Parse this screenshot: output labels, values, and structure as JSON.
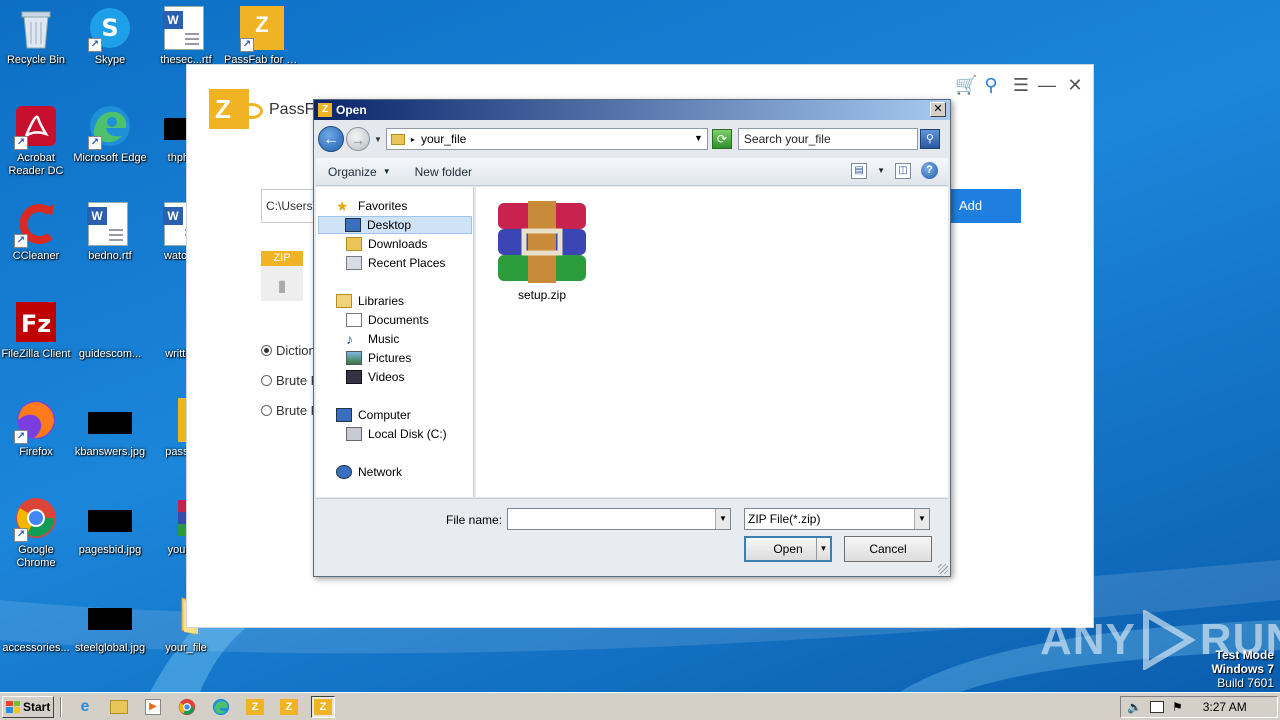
{
  "desktop": {
    "icons": [
      {
        "label": "Recycle Bin"
      },
      {
        "label": "Skype"
      },
      {
        "label": "thesec...rtf"
      },
      {
        "label": "PassFab for ZIP"
      },
      {
        "label": "Acrobat Reader DC"
      },
      {
        "label": "Microsoft Edge"
      },
      {
        "label": "thpha..."
      },
      {
        "label": "CCleaner"
      },
      {
        "label": "bedno.rtf"
      },
      {
        "label": "watche..."
      },
      {
        "label": "FileZilla Client"
      },
      {
        "label": "guidescom..."
      },
      {
        "label": "written..."
      },
      {
        "label": "Firefox"
      },
      {
        "label": "kbanswers.jpg"
      },
      {
        "label": "passfa..."
      },
      {
        "label": "Google Chrome"
      },
      {
        "label": "pagesbid.jpg"
      },
      {
        "label": "your_..."
      },
      {
        "label": "accessories..."
      },
      {
        "label": "steelglobal.jpg"
      },
      {
        "label": "your_file"
      }
    ]
  },
  "passfab": {
    "title": "PassFa",
    "logo_letter": "Z",
    "path_value": "C:\\Users\\",
    "add_label": "Add",
    "zip_tag": "ZIP",
    "radios": [
      {
        "label": "Diction",
        "checked": true
      },
      {
        "label": "Brute F",
        "checked": false
      },
      {
        "label": "Brute F",
        "checked": false
      }
    ]
  },
  "dialog": {
    "title": "Open",
    "close": "✕",
    "address": "your_file",
    "search_placeholder": "Search your_file",
    "toolbar": {
      "organize": "Organize",
      "new_folder": "New folder"
    },
    "nav": {
      "favorites": "Favorites",
      "desktop": "Desktop",
      "downloads": "Downloads",
      "recent": "Recent Places",
      "libraries": "Libraries",
      "documents": "Documents",
      "music": "Music",
      "pictures": "Pictures",
      "videos": "Videos",
      "computer": "Computer",
      "local_disk": "Local Disk (C:)",
      "network": "Network"
    },
    "files": [
      {
        "name": "setup.zip"
      }
    ],
    "filename_label": "File name:",
    "filename_value": "",
    "filetype": "ZIP File(*.zip)",
    "open_label": "Open",
    "cancel_label": "Cancel"
  },
  "taskbar": {
    "start_label": "Start",
    "clock": "3:27 AM"
  },
  "watermark": {
    "text1": "ANY",
    "text2": "RUN"
  },
  "testmode": {
    "line1": "Test Mode",
    "line2": "Windows 7",
    "line3": "Build 7601"
  },
  "colors": {
    "accent": "#1e7fe0",
    "passfab_yellow": "#f0b323",
    "title_bar": "#0a246a"
  }
}
